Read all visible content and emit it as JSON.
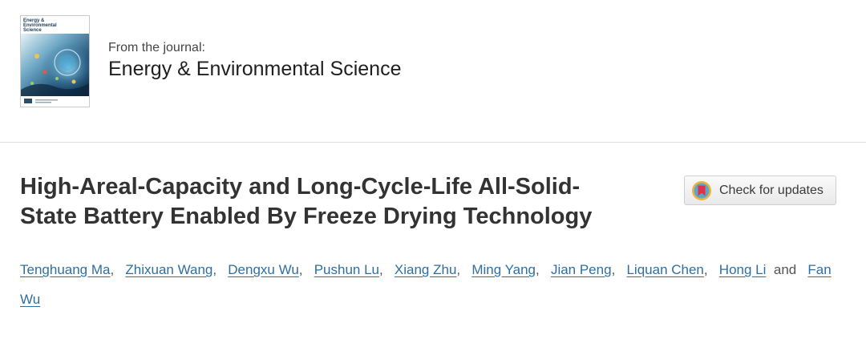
{
  "journal_header": {
    "cover_title_lines": [
      "Energy &",
      "Environmental",
      "Science"
    ],
    "from_label": "From the journal:",
    "journal_name": "Energy & Environmental Science"
  },
  "article": {
    "title_line1": "High-Areal-Capacity and Long-Cycle-Life All-Solid-",
    "title_line2": "State Battery Enabled By Freeze Drying Technology",
    "check_updates_label": "Check for updates",
    "authors": [
      "Tenghuang Ma",
      "Zhixuan Wang",
      "Dengxu Wu",
      "Pushun Lu",
      "Xiang Zhu",
      "Ming Yang",
      "Jian Peng",
      "Liquan Chen",
      "Hong Li",
      "Fan Wu"
    ],
    "author_separator": ",",
    "and_word": "and"
  },
  "colors": {
    "link": "#2f6f9f",
    "title": "#333333",
    "divider": "#dddddd",
    "check_icon_ring": "#f0b23a",
    "check_icon_mark": "#e0304a"
  },
  "icons": {
    "cover": "journal-cover-thumbnail",
    "check_updates": "crossmark-icon"
  }
}
